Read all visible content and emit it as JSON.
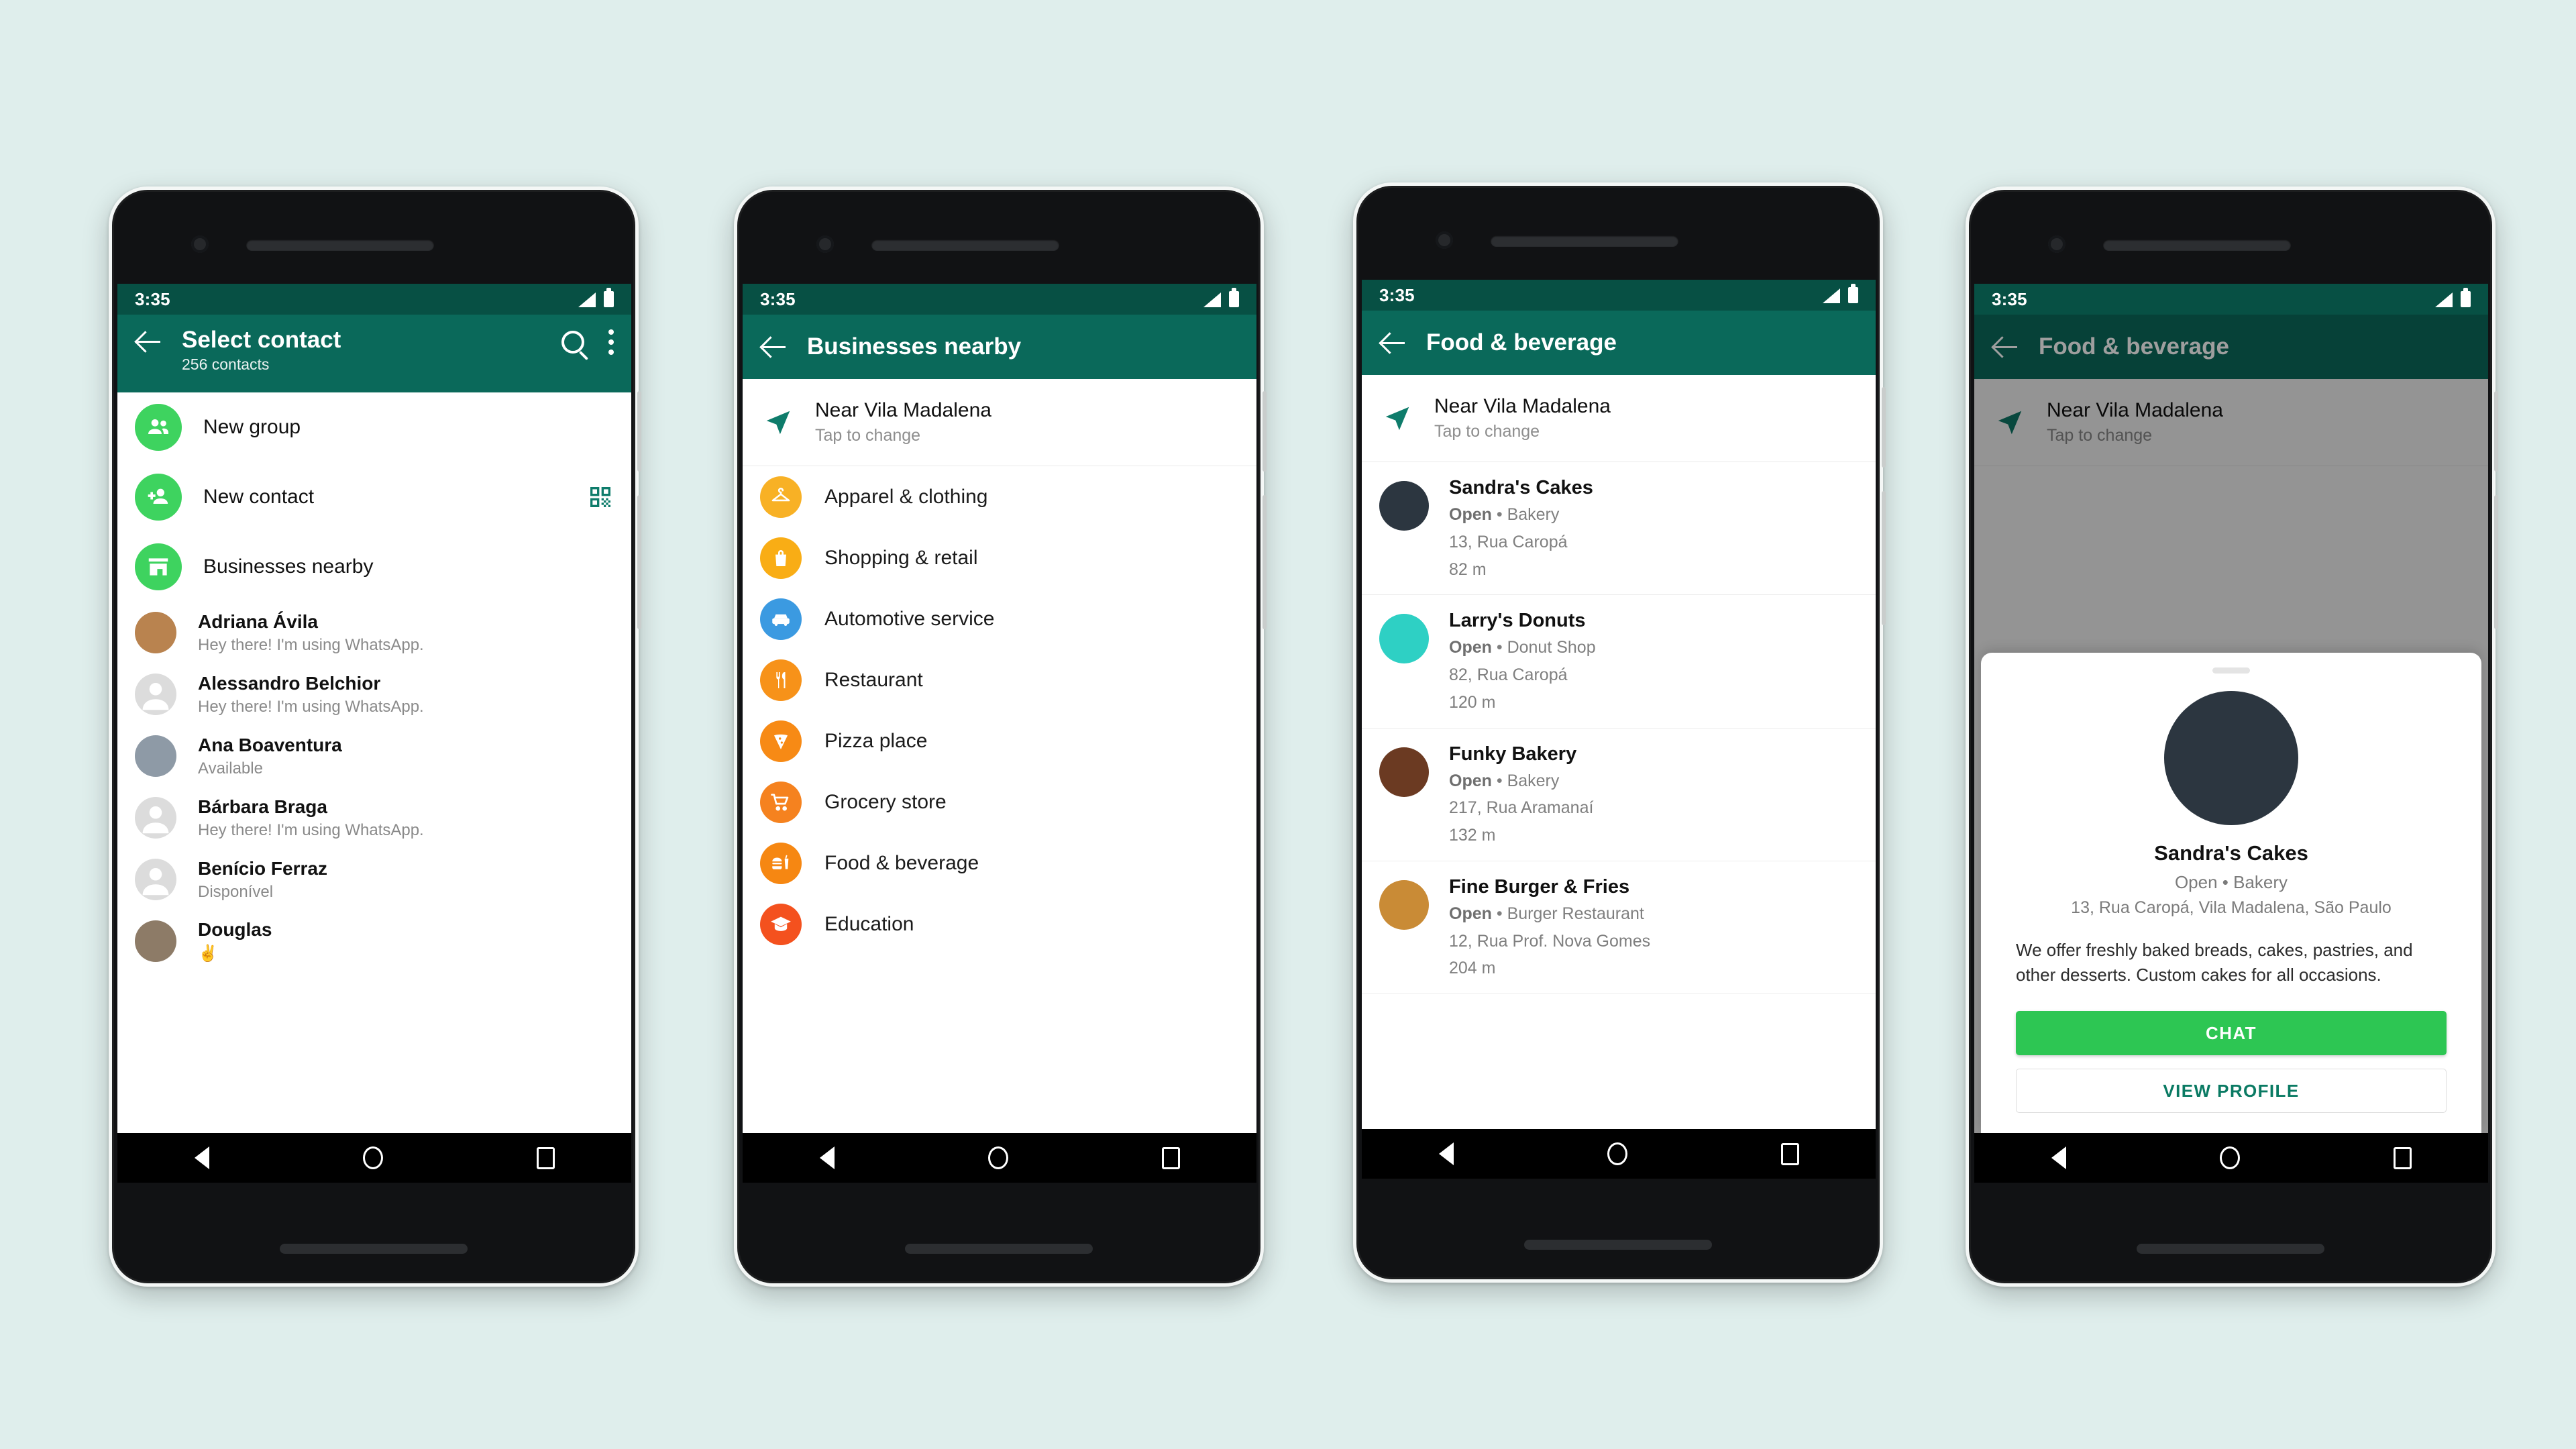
{
  "background_color": "#dfeeec",
  "theme": {
    "status_bar": "#075044",
    "app_bar": "#0a695a",
    "whatsapp_green": "#3ed35f",
    "chat_button": "#2dc653",
    "link_teal": "#0a7a63"
  },
  "status_bar": {
    "time": "3:35",
    "signal_icon": "signal-icon",
    "battery_icon": "battery-icon"
  },
  "nav_bar": {
    "back": "nav-back-icon",
    "home": "nav-home-icon",
    "recents": "nav-recents-icon"
  },
  "phone1": {
    "app_bar": {
      "back_icon": "back-arrow-icon",
      "title": "Select contact",
      "subtitle": "256 contacts",
      "search_icon": "search-icon",
      "overflow_icon": "overflow-menu-icon"
    },
    "actions": [
      {
        "label": "New group",
        "icon": "group-icon"
      },
      {
        "label": "New contact",
        "icon": "person-add-icon",
        "trailing_icon": "qr-code-icon"
      },
      {
        "label": "Businesses nearby",
        "icon": "storefront-icon"
      }
    ],
    "contacts": [
      {
        "name": "Adriana Ávila",
        "status": "Hey there! I'm using WhatsApp.",
        "has_photo": true,
        "photo": "#b9834f"
      },
      {
        "name": "Alessandro Belchior",
        "status": "Hey there! I'm using WhatsApp.",
        "has_photo": false
      },
      {
        "name": "Ana Boaventura",
        "status": "Available",
        "has_photo": true,
        "photo": "#8e9aa6"
      },
      {
        "name": "Bárbara Braga",
        "status": "Hey there! I'm using WhatsApp.",
        "has_photo": false
      },
      {
        "name": "Benício Ferraz",
        "status": "Disponível",
        "has_photo": false
      },
      {
        "name": "Douglas",
        "status": "✌️",
        "has_photo": true,
        "photo": "#8d7b67"
      }
    ]
  },
  "phone2": {
    "app_bar": {
      "back_icon": "back-arrow-icon",
      "title": "Businesses nearby"
    },
    "location": {
      "icon": "navigation-arrow-icon",
      "title": "Near Vila Madalena",
      "subtitle": "Tap to change"
    },
    "categories": [
      {
        "label": "Apparel & clothing",
        "icon": "hanger-icon",
        "color": "#f8b125"
      },
      {
        "label": "Shopping & retail",
        "icon": "shopping-bag-icon",
        "color": "#f9ad15"
      },
      {
        "label": "Automotive service",
        "icon": "car-icon",
        "color": "#3b9ae1"
      },
      {
        "label": "Restaurant",
        "icon": "cutlery-icon",
        "color": "#f79219"
      },
      {
        "label": "Pizza place",
        "icon": "pizza-slice-icon",
        "color": "#f78a15"
      },
      {
        "label": "Grocery store",
        "icon": "shopping-cart-icon",
        "color": "#f5821f"
      },
      {
        "label": "Food & beverage",
        "icon": "burger-drink-icon",
        "color": "#f68712"
      },
      {
        "label": "Education",
        "icon": "graduation-cap-icon",
        "color": "#f4511e"
      }
    ]
  },
  "phone3": {
    "app_bar": {
      "back_icon": "back-arrow-icon",
      "title": "Food & beverage"
    },
    "location": {
      "icon": "navigation-arrow-icon",
      "title": "Near Vila Madalena",
      "subtitle": "Tap to change"
    },
    "businesses": [
      {
        "name": "Sandra's Cakes",
        "status": "Open",
        "category": "Bakery",
        "address": "13, Rua Caropá",
        "distance": "82 m",
        "photo": "#2c3640"
      },
      {
        "name": "Larry's Donuts",
        "status": "Open",
        "category": "Donut Shop",
        "address": "82, Rua Caropá",
        "distance": "120 m",
        "photo": "#2ed0c4"
      },
      {
        "name": "Funky Bakery",
        "status": "Open",
        "category": "Bakery",
        "address": "217, Rua Aramanaí",
        "distance": "132 m",
        "photo": "#6b3a22"
      },
      {
        "name": "Fine Burger & Fries",
        "status": "Open",
        "category": "Burger Restaurant",
        "address": "12, Rua Prof. Nova Gomes",
        "distance": "204 m",
        "photo": "#c98b36"
      }
    ]
  },
  "phone4": {
    "app_bar": {
      "back_icon": "back-arrow-icon",
      "title": "Food & beverage"
    },
    "location": {
      "icon": "navigation-arrow-icon",
      "title": "Near Vila Madalena",
      "subtitle": "Tap to change"
    },
    "profile_sheet": {
      "drag_handle": "drag-handle",
      "photo": "#2c3640",
      "name": "Sandra's Cakes",
      "status_line": "Open • Bakery",
      "address": "13, Rua Caropá, Vila Madalena, São Paulo",
      "description": "We offer freshly baked breads, cakes, pastries, and other desserts. Custom cakes for all occasions.",
      "primary_button": "CHAT",
      "secondary_button": "VIEW PROFILE"
    }
  }
}
